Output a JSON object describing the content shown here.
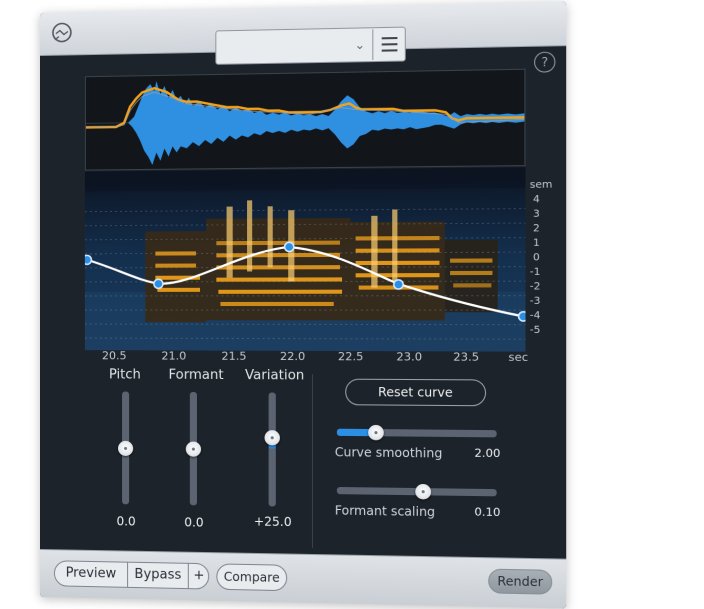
{
  "footer": {
    "preview_label": "Preview",
    "bypass_label": "Bypass",
    "plus_label": "+",
    "compare_label": "Compare",
    "render_label": "Render"
  },
  "header": {
    "help_label": "?"
  },
  "spectrogram": {
    "unit_label": "sem",
    "semitone_ticks": [
      "4",
      "3",
      "2",
      "1",
      "0",
      "-1",
      "-2",
      "-3",
      "-4",
      "-5"
    ],
    "time_ticks": [
      "20.5",
      "21.0",
      "21.5",
      "22.0",
      "22.5",
      "23.0",
      "23.5"
    ],
    "time_unit": "sec"
  },
  "controls": {
    "pitch": {
      "label": "Pitch",
      "value": "0.0",
      "level": 0.5
    },
    "formant": {
      "label": "Formant",
      "value": "0.0",
      "level": 0.5
    },
    "variation": {
      "label": "Variation",
      "value": "+25.0",
      "level": 0.62
    },
    "reset_label": "Reset curve",
    "curve_smoothing": {
      "label": "Curve smoothing",
      "value": "2.00",
      "level": 0.22
    },
    "formant_scaling": {
      "label": "Formant scaling",
      "value": "0.10",
      "level": 0.55
    }
  },
  "colors": {
    "accent": "#2c8fe6",
    "waveform": "#2f8fe0",
    "envelope": "#f2a21a"
  }
}
